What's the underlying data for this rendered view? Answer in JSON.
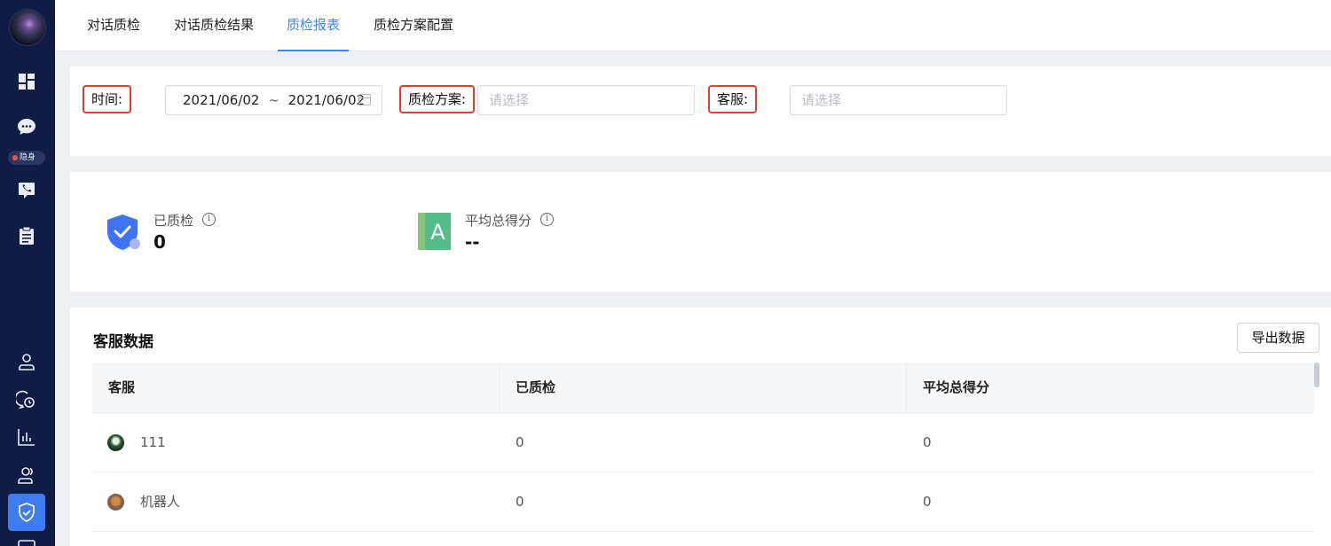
{
  "sidebar": {
    "status_label": "隐身",
    "accent": "#3f7cf0",
    "background": "#0f1d45",
    "icons": [
      "dashboard-icon",
      "chat-icon",
      "phone-chat-icon",
      "clipboard-icon",
      "user-icon",
      "history-icon",
      "bar-chart-icon",
      "users-icon",
      "shield-check-icon",
      "message-icon"
    ]
  },
  "tabs": [
    {
      "label": "对话质检",
      "active": false
    },
    {
      "label": "对话质检结果",
      "active": false
    },
    {
      "label": "质检报表",
      "active": true
    },
    {
      "label": "质检方案配置",
      "active": false
    }
  ],
  "filters": {
    "time_label": "时间:",
    "date_start": "2021/06/02",
    "date_sep": "~",
    "date_end": "2021/06/02",
    "plan_label": "质检方案:",
    "plan_placeholder": "请选择",
    "agent_label": "客服:",
    "agent_placeholder": "请选择"
  },
  "stats": {
    "inspected_label": "已质检",
    "inspected_value": "0",
    "avg_score_label": "平均总得分",
    "avg_score_value": "--"
  },
  "table": {
    "title": "客服数据",
    "export_label": "导出数据",
    "columns": [
      "客服",
      "已质检",
      "平均总得分"
    ],
    "rows": [
      {
        "agent": "111",
        "inspected": "0",
        "avg_score": "0"
      },
      {
        "agent": "机器人",
        "inspected": "0",
        "avg_score": "0"
      }
    ]
  }
}
